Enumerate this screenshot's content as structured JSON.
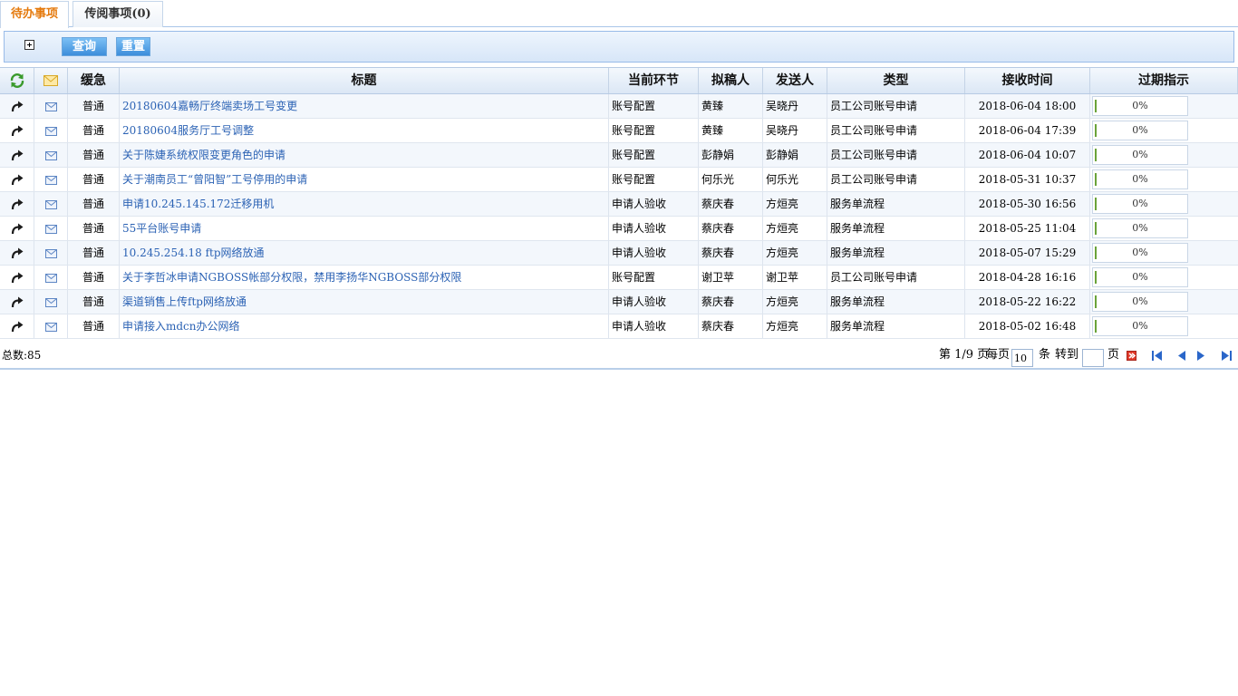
{
  "tabs": [
    {
      "label": "待办事项"
    },
    {
      "label": "传阅事项(0)"
    }
  ],
  "toolbar": {
    "query_label": "查询",
    "reset_label": "重置"
  },
  "columns": {
    "urgency": "缓急",
    "title": "标题",
    "node": "当前环节",
    "drafter": "拟稿人",
    "sender": "发送人",
    "type": "类型",
    "received": "接收时间",
    "expiry": "过期指示"
  },
  "rows": [
    {
      "urgency": "普通",
      "title": "20180604嘉畅厅终端卖场工号变更",
      "node": "账号配置",
      "drafter": "黄臻",
      "sender": "吴晓丹",
      "type": "员工公司账号申请",
      "received": "2018-06-04 18:00",
      "expiry": "0%"
    },
    {
      "urgency": "普通",
      "title": "20180604服务厅工号调整",
      "node": "账号配置",
      "drafter": "黄臻",
      "sender": "吴晓丹",
      "type": "员工公司账号申请",
      "received": "2018-06-04 17:39",
      "expiry": "0%"
    },
    {
      "urgency": "普通",
      "title": "关于陈婕系统权限变更角色的申请",
      "node": "账号配置",
      "drafter": "彭静娟",
      "sender": "彭静娟",
      "type": "员工公司账号申请",
      "received": "2018-06-04 10:07",
      "expiry": "0%"
    },
    {
      "urgency": "普通",
      "title": "关于潮南员工“曾阳智”工号停用的申请",
      "node": "账号配置",
      "drafter": "何乐光",
      "sender": "何乐光",
      "type": "员工公司账号申请",
      "received": "2018-05-31 10:37",
      "expiry": "0%"
    },
    {
      "urgency": "普通",
      "title": "申请10.245.145.172迁移用机",
      "node": "申请人验收",
      "drafter": "蔡庆春",
      "sender": "方烜亮",
      "type": "服务单流程",
      "received": "2018-05-30 16:56",
      "expiry": "0%"
    },
    {
      "urgency": "普通",
      "title": "55平台账号申请",
      "node": "申请人验收",
      "drafter": "蔡庆春",
      "sender": "方烜亮",
      "type": "服务单流程",
      "received": "2018-05-25 11:04",
      "expiry": "0%"
    },
    {
      "urgency": "普通",
      "title": "10.245.254.18 ftp网络放通",
      "node": "申请人验收",
      "drafter": "蔡庆春",
      "sender": "方烜亮",
      "type": "服务单流程",
      "received": "2018-05-07 15:29",
      "expiry": "0%"
    },
    {
      "urgency": "普通",
      "title": "关于李哲冰申请NGBOSS帐部分权限，禁用李扬华NGBOSS部分权限",
      "node": "账号配置",
      "drafter": "谢卫苹",
      "sender": "谢卫苹",
      "type": "员工公司账号申请",
      "received": "2018-04-28 16:16",
      "expiry": "0%"
    },
    {
      "urgency": "普通",
      "title": "渠道销售上传ftp网络放通",
      "node": "申请人验收",
      "drafter": "蔡庆春",
      "sender": "方烜亮",
      "type": "服务单流程",
      "received": "2018-05-22 16:22",
      "expiry": "0%"
    },
    {
      "urgency": "普通",
      "title": "申请接入mdcn办公网络",
      "node": "申请人验收",
      "drafter": "蔡庆春",
      "sender": "方烜亮",
      "type": "服务单流程",
      "received": "2018-05-02 16:48",
      "expiry": "0%"
    }
  ],
  "footer": {
    "total": "总数:85",
    "page_info": "第 1/9 页",
    "per_page_label": "每页",
    "per_page_value": "10",
    "items_label": "条",
    "goto_label": "转到",
    "goto_value": "",
    "page_label": "页"
  },
  "colors": {
    "accent": "#e57a0d",
    "link": "#2b62b4",
    "button": "#3d8edb",
    "progress": "#6aa33a"
  },
  "icons": {
    "header_action": "refresh-icon",
    "header_mail": "mail-icon",
    "row_action": "forward-arrow-icon",
    "row_mail": "envelope-icon",
    "go": "go-icon",
    "first": "first-page-icon",
    "prev": "prev-page-icon",
    "next": "next-page-icon",
    "last": "last-page-icon"
  }
}
